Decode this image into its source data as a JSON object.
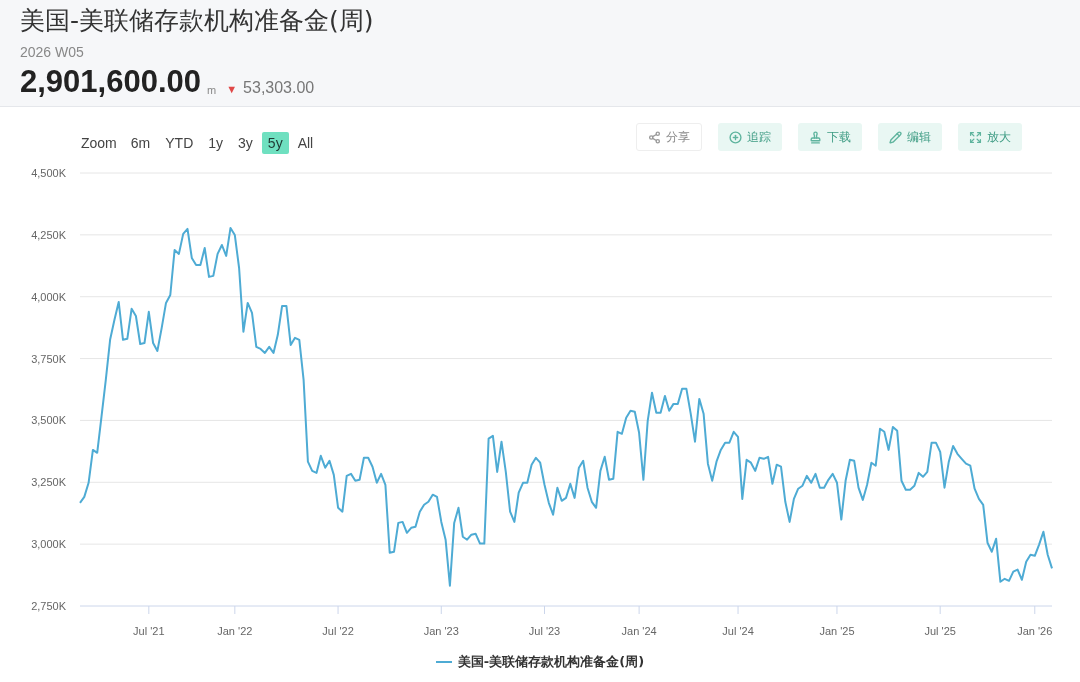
{
  "header": {
    "title": "美国-美联储存款机构准备金(周)",
    "period": "2026 W05",
    "value": "2,901,600.00",
    "unit": "m",
    "change": {
      "arrow": "▼",
      "value": "53,303.00"
    }
  },
  "range_selector": {
    "label": "Zoom",
    "options": [
      {
        "label": "6m",
        "selected": false
      },
      {
        "label": "YTD",
        "selected": false
      },
      {
        "label": "1y",
        "selected": false
      },
      {
        "label": "3y",
        "selected": false
      },
      {
        "label": "5y",
        "selected": true
      },
      {
        "label": "All",
        "selected": false
      }
    ]
  },
  "toolbar": [
    {
      "kind": "share",
      "label": "分享"
    },
    {
      "kind": "follow",
      "label": "追踪"
    },
    {
      "kind": "download",
      "label": "下载"
    },
    {
      "kind": "edit",
      "label": "编辑"
    },
    {
      "kind": "expand",
      "label": "放大"
    }
  ],
  "chart": {
    "chart_data": {
      "type": "line",
      "grid": true,
      "ylim": [
        2750,
        4500
      ],
      "yticks": [
        {
          "value": 2750,
          "label": "2,750K"
        },
        {
          "value": 3000,
          "label": "3,000K"
        },
        {
          "value": 3250,
          "label": "3,250K"
        },
        {
          "value": 3500,
          "label": "3,500K"
        },
        {
          "value": 3750,
          "label": "3,750K"
        },
        {
          "value": 4000,
          "label": "4,000K"
        },
        {
          "value": 4250,
          "label": "4,250K"
        },
        {
          "value": 4500,
          "label": "4,500K"
        }
      ],
      "categories": [
        null,
        null,
        null,
        null,
        null,
        null,
        null,
        null,
        null,
        null,
        null,
        null,
        null,
        null,
        null,
        null,
        "Jul '21",
        null,
        null,
        null,
        null,
        null,
        null,
        null,
        null,
        null,
        null,
        null,
        null,
        null,
        null,
        null,
        null,
        null,
        null,
        null,
        "Jan '22",
        null,
        null,
        null,
        null,
        null,
        null,
        null,
        null,
        null,
        null,
        null,
        null,
        null,
        null,
        null,
        null,
        null,
        null,
        null,
        null,
        null,
        null,
        null,
        "Jul '22",
        null,
        null,
        null,
        null,
        null,
        null,
        null,
        null,
        null,
        null,
        null,
        null,
        null,
        null,
        null,
        null,
        null,
        null,
        null,
        null,
        null,
        null,
        null,
        "Jan '23",
        null,
        null,
        null,
        null,
        null,
        null,
        null,
        null,
        null,
        null,
        null,
        null,
        null,
        null,
        null,
        null,
        null,
        null,
        null,
        null,
        null,
        null,
        null,
        "Jul '23",
        null,
        null,
        null,
        null,
        null,
        null,
        null,
        null,
        null,
        null,
        null,
        null,
        null,
        null,
        null,
        null,
        null,
        null,
        null,
        null,
        null,
        "Jan '24",
        null,
        null,
        null,
        null,
        null,
        null,
        null,
        null,
        null,
        null,
        null,
        null,
        null,
        null,
        null,
        null,
        null,
        null,
        null,
        null,
        null,
        null,
        "Jul '24",
        null,
        null,
        null,
        null,
        null,
        null,
        null,
        null,
        null,
        null,
        null,
        null,
        null,
        null,
        null,
        null,
        null,
        null,
        null,
        null,
        null,
        null,
        "Jan '25",
        null,
        null,
        null,
        null,
        null,
        null,
        null,
        null,
        null,
        null,
        null,
        null,
        null,
        null,
        null,
        null,
        null,
        null,
        null,
        null,
        null,
        null,
        null,
        "Jul '25",
        null,
        null,
        null,
        null,
        null,
        null,
        null,
        null,
        null,
        null,
        null,
        null,
        null,
        null,
        null,
        null,
        null,
        null,
        null,
        null,
        null,
        "Jan '26",
        null,
        null,
        null,
        null
      ],
      "series": [
        {
          "name": "美国-美联储存款机构准备金(周)",
          "color": "#4eabd4",
          "values": [
            3167,
            3191,
            3248,
            3381,
            3369,
            3515,
            3664,
            3826,
            3906,
            3979,
            3826,
            3830,
            3951,
            3922,
            3809,
            3813,
            3939,
            3813,
            3781,
            3874,
            3975,
            4007,
            4189,
            4173,
            4254,
            4274,
            4157,
            4128,
            4128,
            4197,
            4080,
            4084,
            4173,
            4209,
            4165,
            4278,
            4250,
            4116,
            3858,
            3975,
            3935,
            3797,
            3789,
            3773,
            3797,
            3773,
            3846,
            3963,
            3963,
            3805,
            3834,
            3826,
            3664,
            3333,
            3296,
            3288,
            3357,
            3309,
            3337,
            3280,
            3147,
            3131,
            3276,
            3284,
            3256,
            3260,
            3349,
            3349,
            3313,
            3248,
            3284,
            3240,
            2965,
            2969,
            3086,
            3090,
            3046,
            3066,
            3070,
            3131,
            3159,
            3171,
            3200,
            3191,
            3090,
            3018,
            2832,
            3086,
            3147,
            3030,
            3018,
            3038,
            3042,
            3002,
            3002,
            3426,
            3438,
            3292,
            3414,
            3292,
            3131,
            3090,
            3208,
            3248,
            3248,
            3321,
            3349,
            3329,
            3240,
            3167,
            3119,
            3228,
            3175,
            3187,
            3244,
            3187,
            3309,
            3337,
            3228,
            3171,
            3147,
            3296,
            3353,
            3260,
            3264,
            3454,
            3446,
            3511,
            3539,
            3535,
            3450,
            3260,
            3498,
            3612,
            3531,
            3531,
            3599,
            3539,
            3567,
            3567,
            3628,
            3628,
            3527,
            3414,
            3587,
            3527,
            3325,
            3256,
            3333,
            3381,
            3410,
            3410,
            3454,
            3434,
            3183,
            3341,
            3329,
            3296,
            3349,
            3345,
            3353,
            3244,
            3321,
            3313,
            3171,
            3090,
            3183,
            3224,
            3236,
            3276,
            3248,
            3284,
            3228,
            3228,
            3260,
            3284,
            3248,
            3099,
            3256,
            3341,
            3337,
            3228,
            3179,
            3240,
            3329,
            3317,
            3466,
            3454,
            3381,
            3474,
            3458,
            3256,
            3220,
            3220,
            3236,
            3288,
            3272,
            3292,
            3410,
            3410,
            3373,
            3228,
            3333,
            3397,
            3365,
            3345,
            3325,
            3317,
            3224,
            3183,
            3159,
            3006,
            2969,
            3022,
            2848,
            2860,
            2852,
            2889,
            2897,
            2856,
            2929,
            2957,
            2953,
            2998,
            3050,
            2957,
            2902
          ]
        }
      ]
    }
  }
}
